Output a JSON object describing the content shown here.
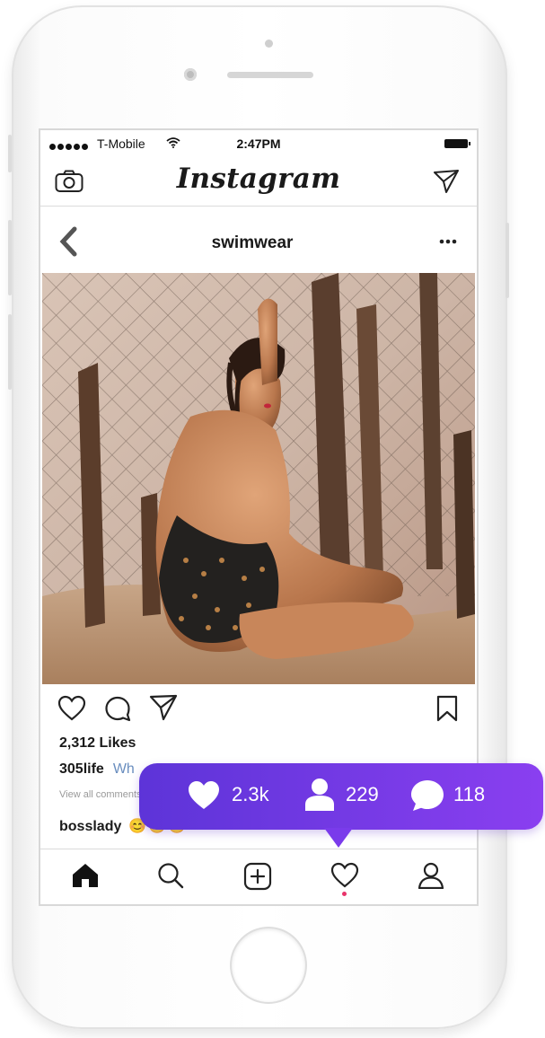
{
  "status_bar": {
    "carrier": "T-Mobile",
    "time": "2:47PM"
  },
  "app": {
    "logo": "Instagram"
  },
  "post": {
    "username": "swimwear",
    "likes": "2,312 Likes",
    "captions": [
      {
        "user": "305life",
        "text": "Wh"
      },
      {
        "user": "bosslady",
        "text": "😊😊😊"
      }
    ],
    "view_all": "View all comments"
  },
  "stats": {
    "likes": "2.3k",
    "followers": "229",
    "comments": "118"
  },
  "icons": {
    "top_left": "camera-icon",
    "top_right": "send-icon",
    "back": "back-chevron-icon",
    "more": "more-icon",
    "actions": [
      "heart-icon",
      "comment-icon",
      "share-icon",
      "bookmark-icon"
    ],
    "tabs": [
      "home-icon",
      "search-icon",
      "add-icon",
      "activity-icon",
      "profile-icon"
    ]
  },
  "colors": {
    "stats_gradient_start": "#5d34d8",
    "stats_gradient_end": "#8a3ff0",
    "notification_dot": "#e8336a"
  }
}
